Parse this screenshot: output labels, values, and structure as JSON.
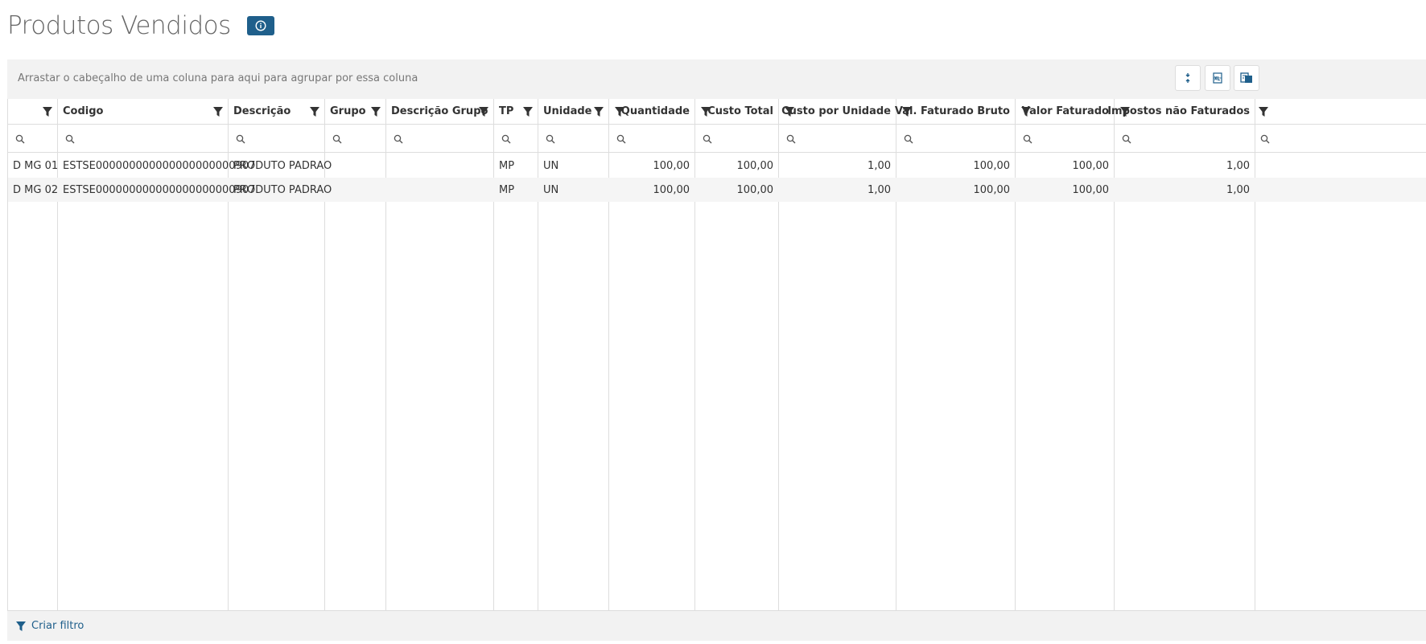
{
  "page": {
    "title": "Produtos Vendidos"
  },
  "grid": {
    "group_hint": "Arrastar o cabeçalho de uma coluna para aqui para agrupar por essa coluna",
    "columns": [
      {
        "label": ""
      },
      {
        "label": "Codigo"
      },
      {
        "label": "Descrição"
      },
      {
        "label": "Grupo"
      },
      {
        "label": "Descrição Grupo"
      },
      {
        "label": "TP"
      },
      {
        "label": "Unidade"
      },
      {
        "label": "Quantidade"
      },
      {
        "label": "Custo Total"
      },
      {
        "label": "Custo por Unidade"
      },
      {
        "label": "Val. Faturado Bruto"
      },
      {
        "label": "Valor Faturado"
      },
      {
        "label": "Impostos não Faturados"
      }
    ],
    "rows": [
      [
        "D MG 01",
        "ESTSE000000000000000000000907",
        "PRODUTO PADRAO",
        "",
        "",
        "MP",
        "UN",
        "100,00",
        "100,00",
        "1,00",
        "100,00",
        "100,00",
        "1,00"
      ],
      [
        "D MG 02",
        "ESTSE000000000000000000000907",
        "PRODUTO PADRAO",
        "",
        "",
        "MP",
        "UN",
        "100,00",
        "100,00",
        "1,00",
        "100,00",
        "100,00",
        "1,00"
      ]
    ],
    "create_filter_label": "Criar filtro"
  },
  "colors": {
    "accent": "#1f5f8b",
    "panel": "#f2f2f2",
    "border": "#dddddd"
  }
}
